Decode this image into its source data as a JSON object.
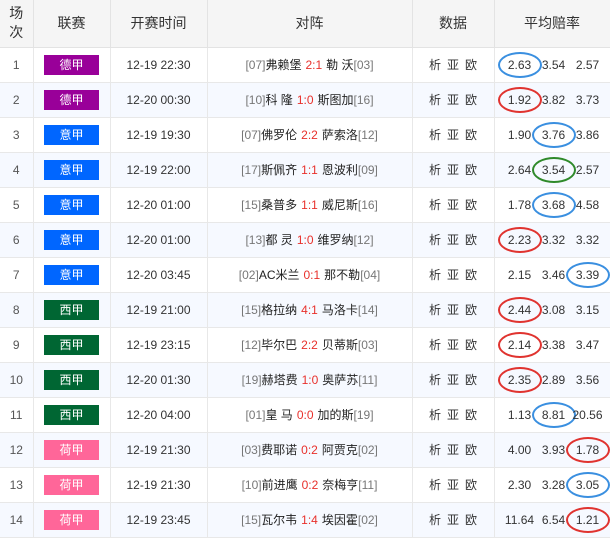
{
  "header": {
    "num_line1": "场",
    "num_line2": "次",
    "league": "联赛",
    "start_time": "开赛时间",
    "match": "对阵",
    "data": "数据",
    "avg_odds": "平均赔率"
  },
  "circle_colors": {
    "blue": "#3a8fe0",
    "red": "#e0332f",
    "green": "#2f8a2a"
  },
  "league_colors": {
    "德甲": "#990099",
    "意甲": "#0066ff",
    "西甲": "#006633",
    "荷甲": "#ff6699"
  },
  "rows": [
    {
      "num": "1",
      "league": "德甲",
      "time": "12-19 22:30",
      "home_rank": "[07]",
      "home": "弗赖堡",
      "score": "2:1",
      "away": "勒 沃",
      "away_rank": "[03]",
      "d1": "析",
      "d2": "亚",
      "d3": "欧",
      "o1": "2.63",
      "o2": "3.54",
      "o3": "2.57",
      "circle_idx": 0,
      "circle": "blue"
    },
    {
      "num": "2",
      "league": "德甲",
      "time": "12-20 00:30",
      "home_rank": "[10]",
      "home": "科 隆",
      "score": "1:0",
      "away": "斯图加",
      "away_rank": "[16]",
      "d1": "析",
      "d2": "亚",
      "d3": "欧",
      "o1": "1.92",
      "o2": "3.82",
      "o3": "3.73",
      "circle_idx": 0,
      "circle": "red"
    },
    {
      "num": "3",
      "league": "意甲",
      "time": "12-19 19:30",
      "home_rank": "[07]",
      "home": "佛罗伦",
      "score": "2:2",
      "away": "萨索洛",
      "away_rank": "[12]",
      "d1": "析",
      "d2": "亚",
      "d3": "欧",
      "o1": "1.90",
      "o2": "3.76",
      "o3": "3.86",
      "circle_idx": 1,
      "circle": "blue"
    },
    {
      "num": "4",
      "league": "意甲",
      "time": "12-19 22:00",
      "home_rank": "[17]",
      "home": "斯佩齐",
      "score": "1:1",
      "away": "恩波利",
      "away_rank": "[09]",
      "d1": "析",
      "d2": "亚",
      "d3": "欧",
      "o1": "2.64",
      "o2": "3.54",
      "o3": "2.57",
      "circle_idx": 1,
      "circle": "green"
    },
    {
      "num": "5",
      "league": "意甲",
      "time": "12-20 01:00",
      "home_rank": "[15]",
      "home": "桑普多",
      "score": "1:1",
      "away": "威尼斯",
      "away_rank": "[16]",
      "d1": "析",
      "d2": "亚",
      "d3": "欧",
      "o1": "1.78",
      "o2": "3.68",
      "o3": "4.58",
      "circle_idx": 1,
      "circle": "blue"
    },
    {
      "num": "6",
      "league": "意甲",
      "time": "12-20 01:00",
      "home_rank": "[13]",
      "home": "都 灵",
      "score": "1:0",
      "away": "维罗纳",
      "away_rank": "[12]",
      "d1": "析",
      "d2": "亚",
      "d3": "欧",
      "o1": "2.23",
      "o2": "3.32",
      "o3": "3.32",
      "circle_idx": 0,
      "circle": "red"
    },
    {
      "num": "7",
      "league": "意甲",
      "time": "12-20 03:45",
      "home_rank": "[02]",
      "home": "AC米兰",
      "score": "0:1",
      "away": "那不勒",
      "away_rank": "[04]",
      "d1": "析",
      "d2": "亚",
      "d3": "欧",
      "o1": "2.15",
      "o2": "3.46",
      "o3": "3.39",
      "circle_idx": 2,
      "circle": "blue"
    },
    {
      "num": "8",
      "league": "西甲",
      "time": "12-19 21:00",
      "home_rank": "[15]",
      "home": "格拉纳",
      "score": "4:1",
      "away": "马洛卡",
      "away_rank": "[14]",
      "d1": "析",
      "d2": "亚",
      "d3": "欧",
      "o1": "2.44",
      "o2": "3.08",
      "o3": "3.15",
      "circle_idx": 0,
      "circle": "red"
    },
    {
      "num": "9",
      "league": "西甲",
      "time": "12-19 23:15",
      "home_rank": "[12]",
      "home": "毕尔巴",
      "score": "2:2",
      "away": "贝蒂斯",
      "away_rank": "[03]",
      "d1": "析",
      "d2": "亚",
      "d3": "欧",
      "o1": "2.14",
      "o2": "3.38",
      "o3": "3.47",
      "circle_idx": 0,
      "circle": "red"
    },
    {
      "num": "10",
      "league": "西甲",
      "time": "12-20 01:30",
      "home_rank": "[19]",
      "home": "赫塔费",
      "score": "1:0",
      "away": "奥萨苏",
      "away_rank": "[11]",
      "d1": "析",
      "d2": "亚",
      "d3": "欧",
      "o1": "2.35",
      "o2": "2.89",
      "o3": "3.56",
      "circle_idx": 0,
      "circle": "red"
    },
    {
      "num": "11",
      "league": "西甲",
      "time": "12-20 04:00",
      "home_rank": "[01]",
      "home": "皇 马",
      "score": "0:0",
      "away": "加的斯",
      "away_rank": "[19]",
      "d1": "析",
      "d2": "亚",
      "d3": "欧",
      "o1": "1.13",
      "o2": "8.81",
      "o3": "20.56",
      "circle_idx": 1,
      "circle": "blue"
    },
    {
      "num": "12",
      "league": "荷甲",
      "time": "12-19 21:30",
      "home_rank": "[03]",
      "home": "费耶诺",
      "score": "0:2",
      "away": "阿贾克",
      "away_rank": "[02]",
      "d1": "析",
      "d2": "亚",
      "d3": "欧",
      "o1": "4.00",
      "o2": "3.93",
      "o3": "1.78",
      "circle_idx": 2,
      "circle": "red"
    },
    {
      "num": "13",
      "league": "荷甲",
      "time": "12-19 21:30",
      "home_rank": "[10]",
      "home": "前进鹰",
      "score": "0:2",
      "away": "奈梅亨",
      "away_rank": "[11]",
      "d1": "析",
      "d2": "亚",
      "d3": "欧",
      "o1": "2.30",
      "o2": "3.28",
      "o3": "3.05",
      "circle_idx": 2,
      "circle": "blue"
    },
    {
      "num": "14",
      "league": "荷甲",
      "time": "12-19 23:45",
      "home_rank": "[15]",
      "home": "瓦尔韦",
      "score": "1:4",
      "away": "埃因霍",
      "away_rank": "[02]",
      "d1": "析",
      "d2": "亚",
      "d3": "欧",
      "o1": "11.64",
      "o2": "6.54",
      "o3": "1.21",
      "circle_idx": 2,
      "circle": "red"
    }
  ]
}
